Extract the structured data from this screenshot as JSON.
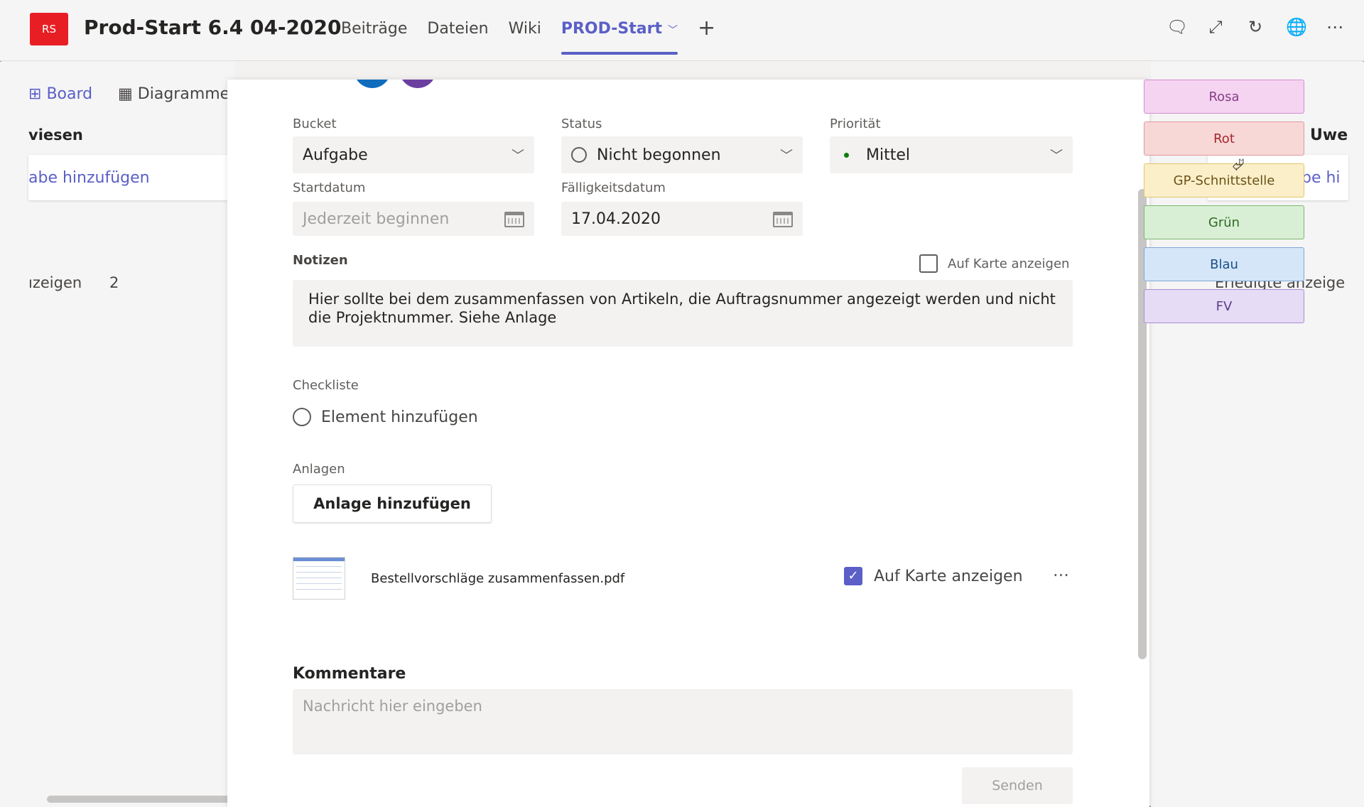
{
  "header": {
    "logo_text": "RS",
    "team_title": "Prod-Start 6.4 04-2020",
    "tabs": [
      {
        "label": "Beiträge"
      },
      {
        "label": "Dateien"
      },
      {
        "label": "Wiki"
      },
      {
        "label": "PROD-Start"
      }
    ],
    "add_tab": "+",
    "icons": [
      "chat-icon",
      "expand-icon",
      "refresh-icon",
      "globe-icon",
      "more-icon"
    ]
  },
  "board": {
    "view_board": "Board",
    "view_diagram": "Diagramme",
    "bucket_name": "viesen",
    "add_task": "abe hinzufügen",
    "completed_label": "ızeigen",
    "completed_count": "2",
    "right_member": "Uwe",
    "right_add_task": "be hi",
    "right_completed": "Erledigte anzeige"
  },
  "labels": [
    {
      "name": "Rosa",
      "bg": "#f4d4f1",
      "border": "#d48ed0",
      "color": "#8a3d88"
    },
    {
      "name": "Rot",
      "bg": "#f8d7d7",
      "border": "#e09a9a",
      "color": "#a4262c"
    },
    {
      "name": "GP-Schnittstelle",
      "bg": "#fbefc9",
      "border": "#e2c56e",
      "color": "#6b5317"
    },
    {
      "name": "Grün",
      "bg": "#d9efd5",
      "border": "#7bb86f",
      "color": "#2e6b24"
    },
    {
      "name": "Blau",
      "bg": "#d4e6f8",
      "border": "#7ea8d8",
      "color": "#1d4f8a"
    },
    {
      "name": "FV",
      "bg": "#e6dcf5",
      "border": "#a78fd0",
      "color": "#5a3d8a"
    }
  ],
  "task": {
    "bucket_label": "Bucket",
    "bucket_value": "Aufgabe",
    "status_label": "Status",
    "status_value": "Nicht begonnen",
    "priority_label": "Priorität",
    "priority_value": "Mittel",
    "start_label": "Startdatum",
    "start_placeholder": "Jederzeit beginnen",
    "due_label": "Fälligkeitsdatum",
    "due_value": "17.04.2020",
    "notes_label": "Notizen",
    "show_on_card": "Auf Karte anzeigen",
    "notes_text": "Hier sollte bei dem zusammenfassen von Artikeln, die Auftragsnummer angezeigt werden und nicht die Projektnummer. Siehe Anlage",
    "checklist_label": "Checkliste",
    "checklist_add": "Element hinzufügen",
    "attachments_label": "Anlagen",
    "attach_button": "Anlage hinzufügen",
    "attachment_name": "Bestellvorschläge zusammenfassen.pdf",
    "attachment_show_on_card": "Auf Karte anzeigen",
    "attachment_more": "···",
    "comments_label": "Kommentare",
    "comment_placeholder": "Nachricht hier eingeben",
    "send_button": "Senden"
  },
  "colors": {
    "accent": "#5b5fc7",
    "logo": "#e81e25",
    "avatar1": "#0f6cbd",
    "avatar2": "#6b3fa0"
  }
}
